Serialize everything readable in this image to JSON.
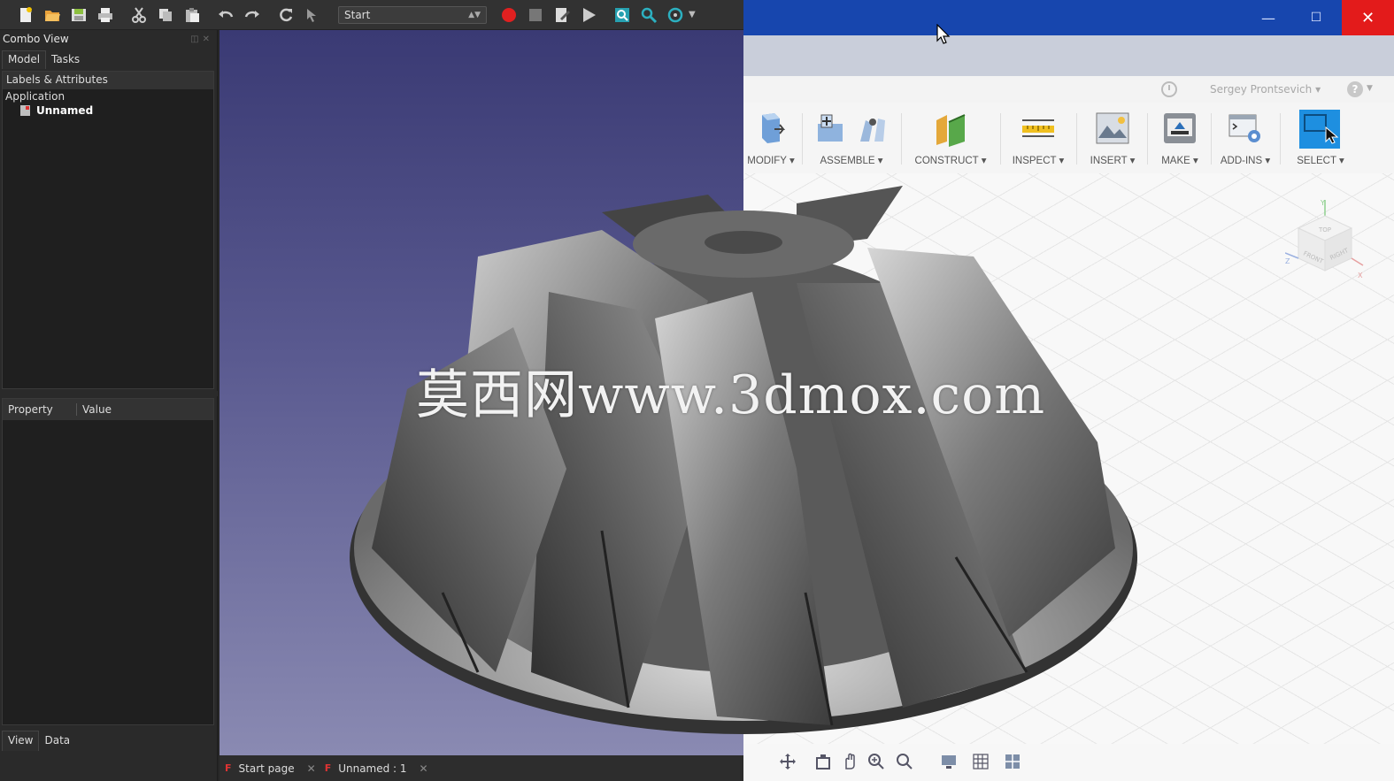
{
  "freecad": {
    "toolbar": {
      "workbench": "Start",
      "icons": [
        "new-icon",
        "open-icon",
        "save-icon",
        "print-icon",
        "cut-icon",
        "copy-icon",
        "paste-icon",
        "undo-icon",
        "redo-icon",
        "refresh-icon",
        "whats-this-icon",
        "macro-record-icon",
        "macro-stop-icon",
        "macro-edit-icon",
        "macro-run-icon",
        "fit-all-icon",
        "zoom-icon",
        "sync-view-icon"
      ]
    },
    "combo_view": {
      "title": "Combo View",
      "tabs": [
        "Model",
        "Tasks"
      ],
      "tree_header": "Labels & Attributes",
      "tree_root": "Application",
      "tree_child": "Unnamed",
      "property_header": [
        "Property",
        "Value"
      ],
      "bottom_tabs": [
        "View",
        "Data"
      ]
    },
    "doc_tabs": [
      "Start page",
      "Unnamed : 1"
    ]
  },
  "fusion": {
    "user": "Sergey Prontsevich",
    "help": "?",
    "ribbon": [
      "MODIFY",
      "ASSEMBLE",
      "CONSTRUCT",
      "INSPECT",
      "INSERT",
      "MAKE",
      "ADD-INS",
      "SELECT"
    ],
    "viewcube": {
      "top": "TOP",
      "front": "FRONT",
      "right": "RIGHT"
    },
    "axes": [
      "Z",
      "X",
      "Y"
    ]
  },
  "watermark": "莫西网www.3dmox.com",
  "colors": {
    "fusion_title": "#1746ae",
    "close_button": "#e31b1b",
    "record": "#e02020"
  }
}
